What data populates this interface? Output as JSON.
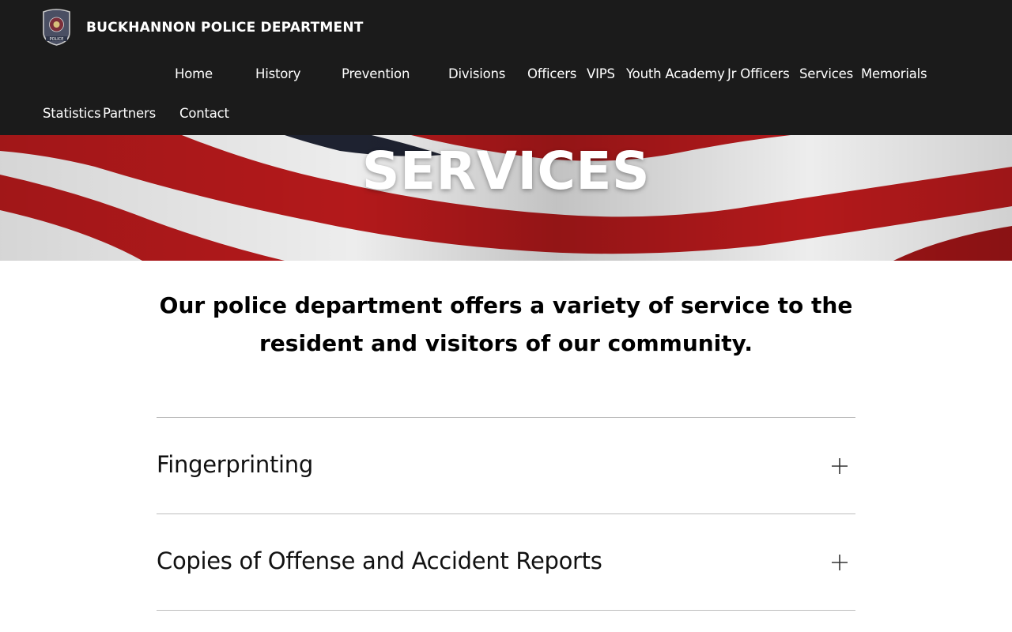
{
  "header": {
    "site_title": "BUCKHANNON POLICE DEPARTMENT",
    "logo_text": "POLICE",
    "nav": {
      "home": "Home",
      "history": "History",
      "prevention": "Prevention",
      "divisions": "Divisions",
      "officers": "Officers",
      "vips": "VIPS",
      "youth_academy": "Youth Academy",
      "jr_officers": "Jr Officers",
      "services": "Services",
      "memorials": "Memorials",
      "statistics": "Statistics",
      "partners": "Partners",
      "contact": "Contact"
    }
  },
  "hero": {
    "title": "SERVICES"
  },
  "intro": {
    "text": "Our police department offers a variety of service to the resident and visitors of our community."
  },
  "accordion": {
    "items": [
      {
        "label": "Fingerprinting",
        "icon": "plus-icon"
      },
      {
        "label": "Copies of Offense and Accident Reports",
        "icon": "plus-icon"
      }
    ]
  },
  "colors": {
    "header_bg": "#1b1b1b",
    "header_text": "#ffffff",
    "flag_red": "#b3191b",
    "flag_white": "#ededed",
    "divider": "#bdbdbd"
  }
}
